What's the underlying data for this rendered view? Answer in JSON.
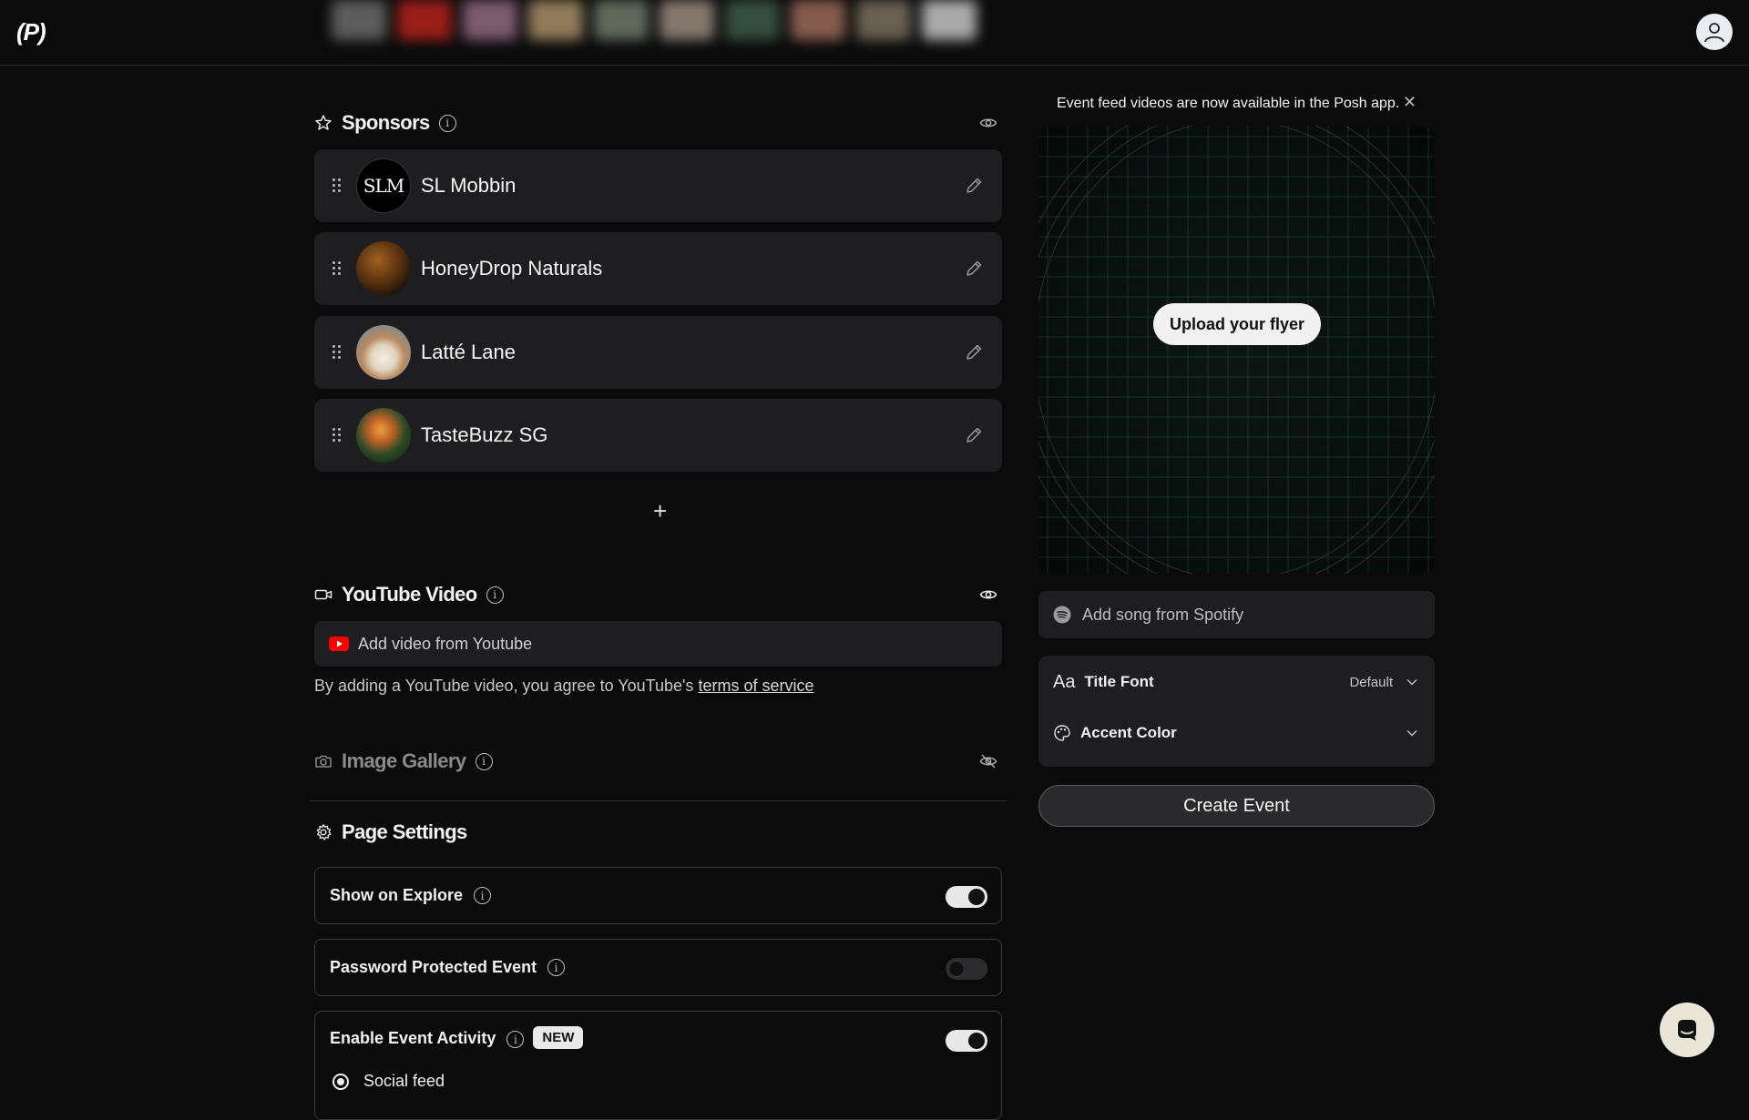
{
  "header": {
    "logo": "(P)",
    "avatar_icon": "user-icon"
  },
  "sponsors": {
    "title": "Sponsors",
    "icon": "star-icon",
    "visibility_icon": "eye-icon",
    "items": [
      {
        "name": "SL Mobbin",
        "avatar": "SLM"
      },
      {
        "name": "HoneyDrop Naturals",
        "avatar": "honey-dipper"
      },
      {
        "name": "Latté Lane",
        "avatar": "latte-cup"
      },
      {
        "name": "TasteBuzz SG",
        "avatar": "peach-in-hand"
      }
    ],
    "add_label": "+"
  },
  "youtube": {
    "title": "YouTube Video",
    "icon": "video-camera-icon",
    "visibility_icon": "eye-icon",
    "placeholder": "Add video from Youtube",
    "note_prefix": "By adding a YouTube video, you agree to YouTube's ",
    "note_link": "terms of service"
  },
  "gallery": {
    "title": "Image Gallery",
    "icon": "camera-icon",
    "visibility_icon": "eye-off-icon"
  },
  "page_settings": {
    "title": "Page Settings",
    "icon": "gear-icon",
    "items": [
      {
        "label": "Show on Explore",
        "enabled": true
      },
      {
        "label": "Password Protected Event",
        "enabled": false
      },
      {
        "label": "Enable Event Activity",
        "badge": "NEW",
        "enabled": true
      }
    ],
    "activity_option": "Social feed"
  },
  "right_panel": {
    "banner": "Event feed videos are now available in the Posh app.",
    "upload_label": "Upload your flyer",
    "spotify_placeholder": "Add song from Spotify",
    "title_font_icon": "Aa",
    "title_font_label": "Title Font",
    "title_font_value": "Default",
    "accent_color_label": "Accent Color",
    "create_label": "Create Event"
  },
  "colors": {
    "background": "#0b0b0c",
    "card": "#1e1e20",
    "youtube_red": "#ff0000"
  }
}
